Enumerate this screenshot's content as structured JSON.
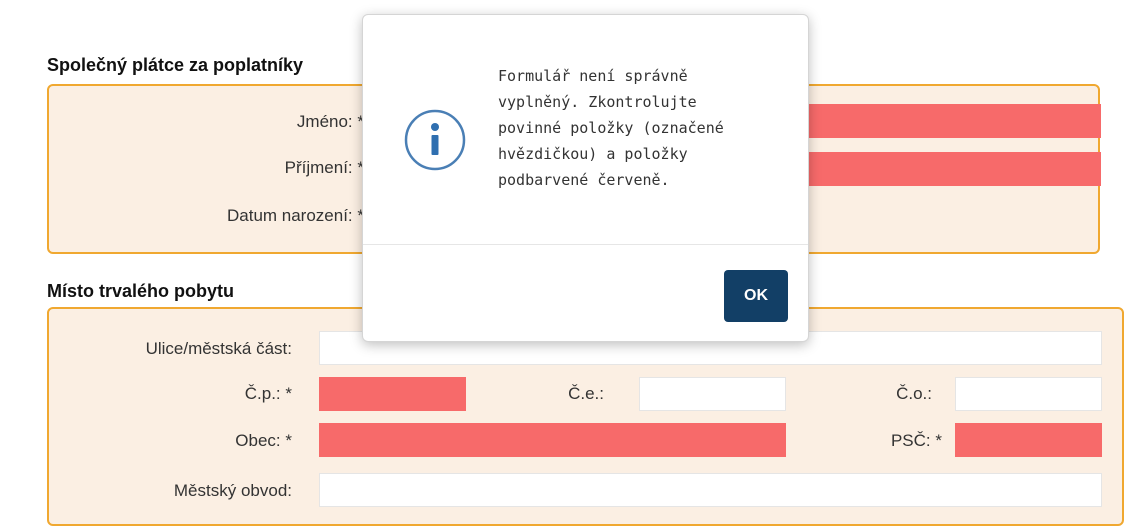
{
  "section1": {
    "title": "Společný plátce za poplatníky",
    "fields": {
      "jmeno": "Jméno: *",
      "prijmeni": "Příjmení: *",
      "datum": "Datum narození: *"
    }
  },
  "section2": {
    "title": "Místo trvalého pobytu",
    "fields": {
      "ulice": "Ulice/městská část:",
      "cp": "Č.p.: *",
      "ce": "Č.e.:",
      "co": "Č.o.:",
      "obec": "Obec: *",
      "psc": "PSČ: *",
      "obvod": "Městský obvod:"
    }
  },
  "modal": {
    "icon": "info-icon",
    "lines": [
      "Formulář není správně",
      "vyplněný. Zkontrolujte",
      "povinné položky (označené",
      "hvězdičkou) a položky",
      "podbarvené červeně."
    ],
    "ok_label": "OK"
  },
  "colors": {
    "panel_bg": "#fbefe3",
    "panel_border": "#f0a830",
    "error_field": "#f76a6a",
    "ok_button": "#123f66"
  }
}
